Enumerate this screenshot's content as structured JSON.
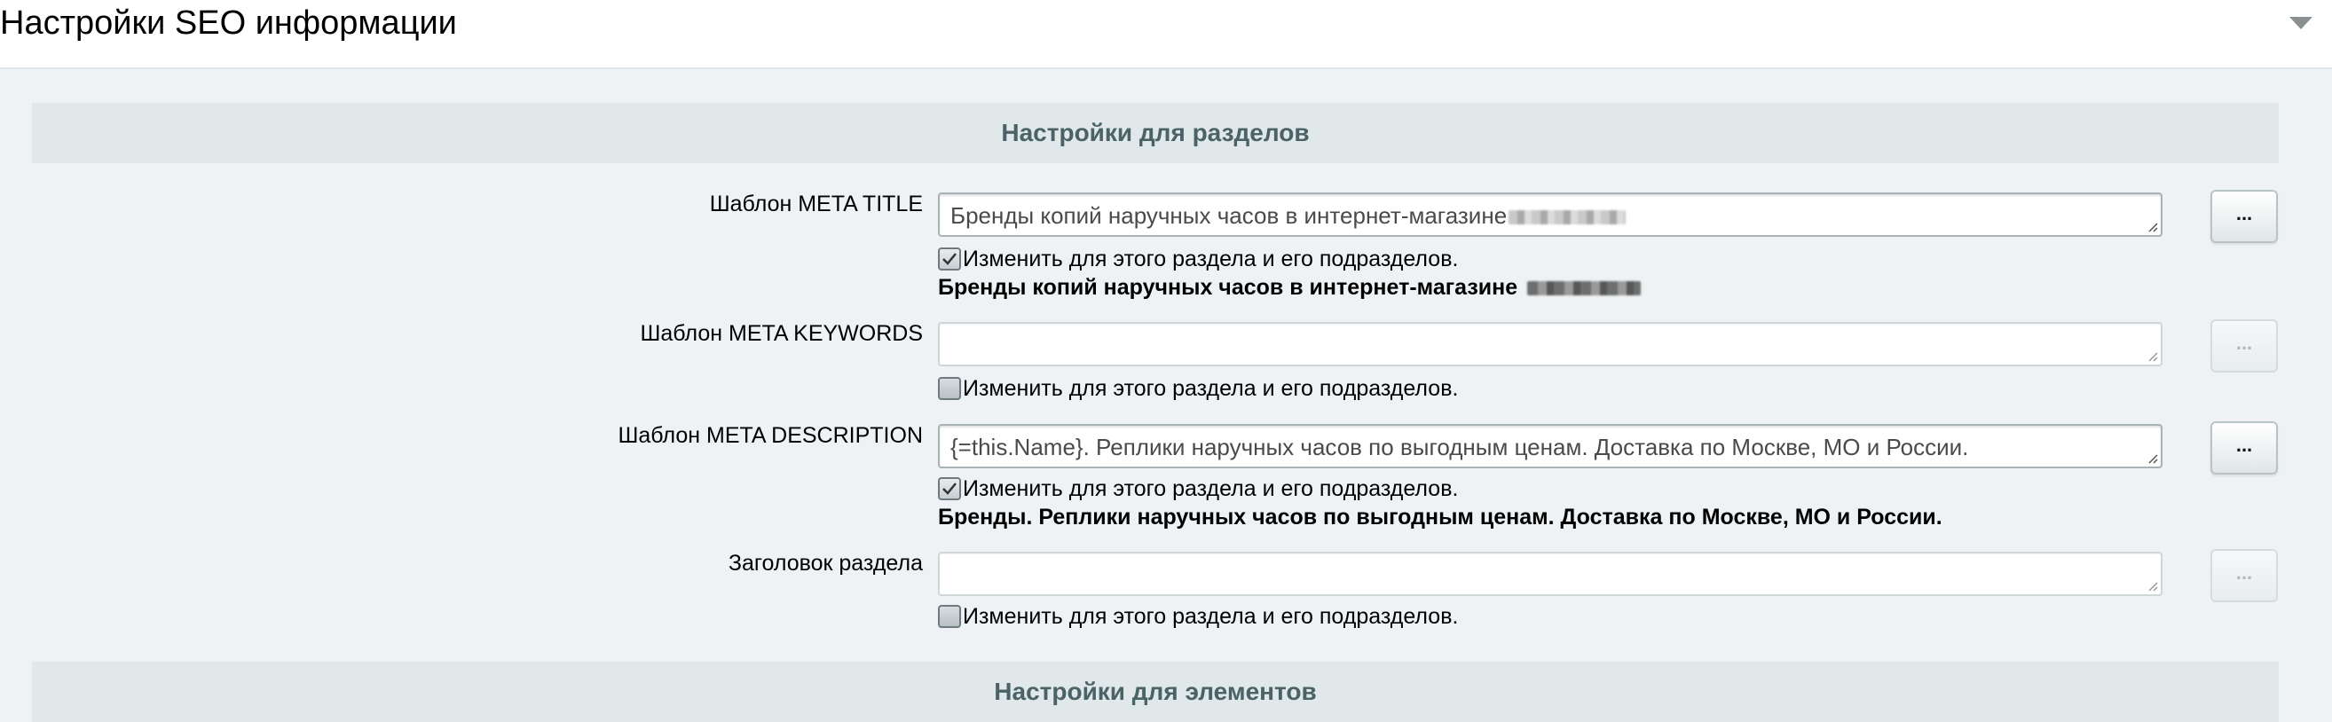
{
  "page": {
    "title": "Настройки SEO информации"
  },
  "sections": {
    "sections_settings": {
      "title": "Настройки для разделов"
    },
    "elements_settings": {
      "title": "Настройки для элементов"
    }
  },
  "fields": {
    "meta_title": {
      "label": "Шаблон META TITLE",
      "value": "Бренды копий наручных часов в интернет-магазине",
      "checkbox_label": "Изменить для этого раздела и его подразделов.",
      "checked": true,
      "preview": "Бренды копий наручных часов в интернет-магазине",
      "button_label": "..."
    },
    "meta_keywords": {
      "label": "Шаблон META KEYWORDS",
      "value": "",
      "checkbox_label": "Изменить для этого раздела и его подразделов.",
      "checked": false,
      "button_label": "..."
    },
    "meta_description": {
      "label": "Шаблон META DESCRIPTION",
      "value": "{=this.Name}. Реплики наручных часов по выгодным ценам. Доставка по Москве, МО и России.",
      "checkbox_label": "Изменить для этого раздела и его подразделов.",
      "checked": true,
      "preview": "Бренды. Реплики наручных часов по выгодным ценам. Доставка по Москве, МО и России.",
      "button_label": "..."
    },
    "section_heading": {
      "label": "Заголовок раздела",
      "value": "",
      "checkbox_label": "Изменить для этого раздела и его подразделов.",
      "checked": false,
      "button_label": "..."
    }
  },
  "icons": {
    "collapse": "chevron-down-icon",
    "check": "checkmark-icon"
  },
  "colors": {
    "section_header_bg": "#e0e8ea",
    "section_header_text": "#4b6267",
    "content_bg": "#eef2f4"
  }
}
